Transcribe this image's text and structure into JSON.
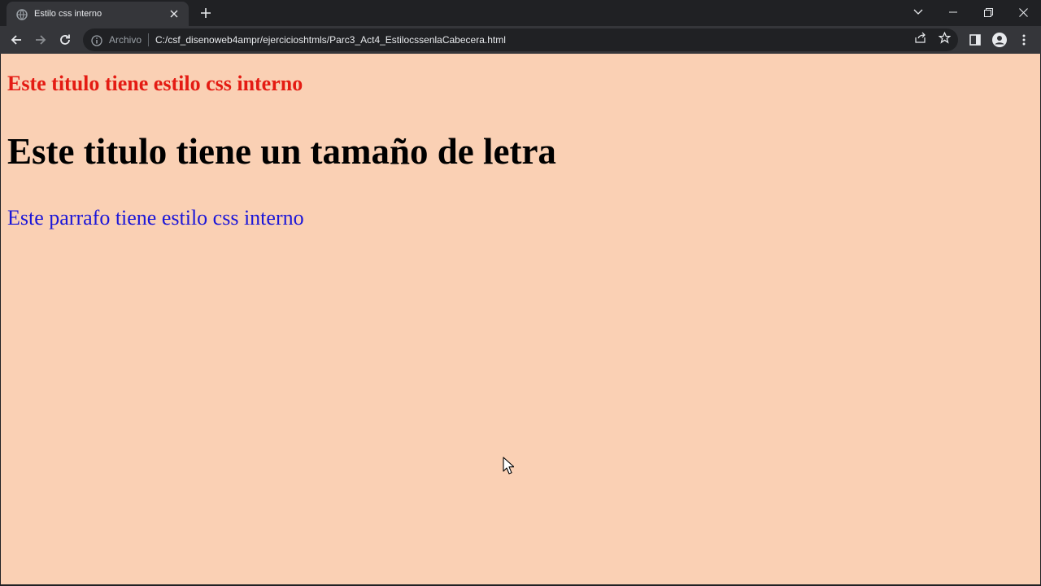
{
  "browser": {
    "tab": {
      "title": "Estilo css interno"
    },
    "omnibox": {
      "origin_label": "Archivo",
      "url": "C:/csf_disenoweb4ampr/ejercicioshtmls/Parc3_Act4_EstilocssenlaCabecera.html"
    }
  },
  "page": {
    "heading_small": "Este titulo tiene estilo css interno",
    "heading_large": "Este titulo tiene un tamaño de letra",
    "paragraph": "Este parrafo tiene estilo css interno"
  },
  "colors": {
    "page_background": "#fad0b4",
    "heading_small": "#e41b13",
    "heading_large": "#000000",
    "paragraph": "#1b16d8",
    "chrome_dark": "#202124",
    "chrome_toolbar": "#35363a"
  },
  "icons": [
    "globe-icon",
    "close-icon",
    "plus-icon",
    "chevron-down-icon",
    "minimize-icon",
    "restore-icon",
    "window-close-icon",
    "back-icon",
    "forward-icon",
    "reload-icon",
    "info-icon",
    "share-icon",
    "star-icon",
    "side-panel-icon",
    "profile-icon",
    "menu-icon",
    "mouse-cursor-icon"
  ]
}
